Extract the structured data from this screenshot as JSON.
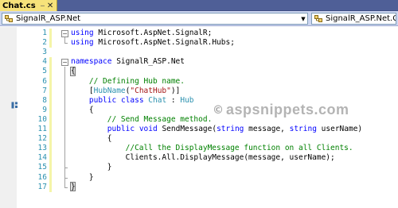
{
  "tab": {
    "label": "Chat.cs"
  },
  "navbar": {
    "class_combo": "SignalR_ASP.Net",
    "member_combo": "SignalR_ASP.Net.Chat"
  },
  "line_numbers": [
    "1",
    "2",
    "3",
    "4",
    "5",
    "6",
    "7",
    "8",
    "9",
    "10",
    "11",
    "12",
    "13",
    "14",
    "15",
    "16",
    "17"
  ],
  "code": [
    [
      {
        "t": "kw",
        "v": "using"
      },
      {
        "t": "",
        "v": " Microsoft.AspNet.SignalR;"
      }
    ],
    [
      {
        "t": "kw",
        "v": "using"
      },
      {
        "t": "",
        "v": " Microsoft.AspNet.SignalR.Hubs;"
      }
    ],
    [],
    [
      {
        "t": "kw",
        "v": "namespace"
      },
      {
        "t": "",
        "v": " SignalR_ASP.Net"
      }
    ],
    [
      {
        "t": "",
        "v": "{"
      }
    ],
    [
      {
        "t": "",
        "v": "    "
      },
      {
        "t": "cm",
        "v": "// Defining Hub name."
      }
    ],
    [
      {
        "t": "",
        "v": "    ["
      },
      {
        "t": "ty",
        "v": "HubName"
      },
      {
        "t": "",
        "v": "("
      },
      {
        "t": "st",
        "v": "\"ChatHub\""
      },
      {
        "t": "",
        "v": ")]"
      }
    ],
    [
      {
        "t": "",
        "v": "    "
      },
      {
        "t": "kw",
        "v": "public"
      },
      {
        "t": "",
        "v": " "
      },
      {
        "t": "kw",
        "v": "class"
      },
      {
        "t": "",
        "v": " "
      },
      {
        "t": "ty",
        "v": "Chat"
      },
      {
        "t": "",
        "v": " : "
      },
      {
        "t": "ty",
        "v": "Hub"
      }
    ],
    [
      {
        "t": "",
        "v": "    {"
      }
    ],
    [
      {
        "t": "",
        "v": "        "
      },
      {
        "t": "cm",
        "v": "// Send Message method."
      }
    ],
    [
      {
        "t": "",
        "v": "        "
      },
      {
        "t": "kw",
        "v": "public"
      },
      {
        "t": "",
        "v": " "
      },
      {
        "t": "kw",
        "v": "void"
      },
      {
        "t": "",
        "v": " SendMessage("
      },
      {
        "t": "kw",
        "v": "string"
      },
      {
        "t": "",
        "v": " message, "
      },
      {
        "t": "kw",
        "v": "string"
      },
      {
        "t": "",
        "v": " userName)"
      }
    ],
    [
      {
        "t": "",
        "v": "        {"
      }
    ],
    [
      {
        "t": "",
        "v": "            "
      },
      {
        "t": "cm",
        "v": "//Call the DisplayMessage function on all Clients."
      }
    ],
    [
      {
        "t": "",
        "v": "            Clients.All.DisplayMessage(message, userName);"
      }
    ],
    [
      {
        "t": "",
        "v": "        }"
      }
    ],
    [
      {
        "t": "",
        "v": "    }"
      }
    ],
    [
      {
        "t": "",
        "v": "}"
      }
    ]
  ],
  "watermark": {
    "icon": "copyright-icon",
    "text": "aspsnippets.com"
  },
  "colors": {
    "keyword": "#0000ff",
    "comment": "#008000",
    "type": "#2b91af",
    "string": "#a31515",
    "tab_active": "#f7e27a",
    "tabbar": "#4f5f97",
    "navbar": "#ccd5f0"
  }
}
